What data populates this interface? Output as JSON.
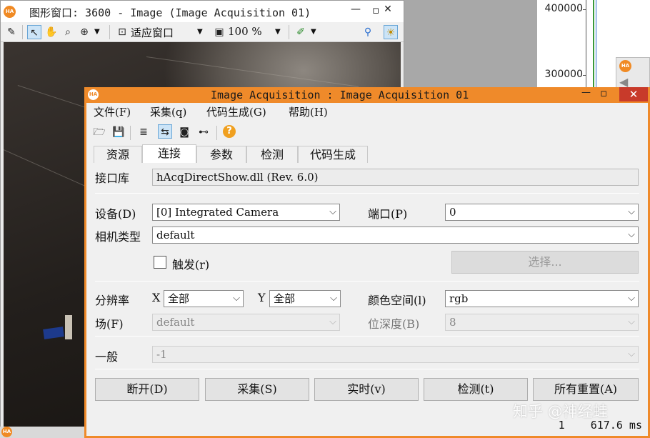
{
  "graphics_window": {
    "title": "图形窗口: 3600 - Image (Image Acquisition 01)",
    "zoom_mode": "适应窗口",
    "zoom_percent": "100 %",
    "min_glyph": "▭",
    "close_glyph": "✕"
  },
  "plot": {
    "y_ticks": [
      "400000",
      "300000"
    ]
  },
  "dialog": {
    "title": "Image Acquisition : Image Acquisition 01",
    "menu": [
      "文件(F)",
      "采集(q)",
      "代码生成(G)",
      "帮助(H)"
    ],
    "tabs": [
      "资源",
      "连接",
      "参数",
      "检测",
      "代码生成"
    ],
    "active_tab": "连接",
    "interface_label": "接口库",
    "interface_value": "hAcqDirectShow.dll (Rev. 6.0)",
    "device_label": "设备(D)",
    "device_value": "[0] Integrated Camera",
    "port_label": "端口(P)",
    "port_value": "0",
    "camera_type_label": "相机类型",
    "camera_type_value": "default",
    "trigger_label": "触发(r)",
    "select_button": "选择...",
    "resolution_label": "分辨率",
    "x_label": "X",
    "x_value": "全部",
    "y_label": "Y",
    "y_value": "全部",
    "color_space_label": "颜色空间(l)",
    "color_space_value": "rgb",
    "field_label": "场(F)",
    "field_value": "default",
    "bit_depth_label": "位深度(B)",
    "bit_depth_value": "8",
    "general_label": "一般",
    "general_value": "-1",
    "buttons": [
      "断开(D)",
      "采集(S)",
      "实时(v)",
      "检测(t)",
      "所有重置(A)"
    ],
    "status_count": "1",
    "status_time": "617.6 ms"
  },
  "watermark": "知乎 @神经蛙",
  "colors": {
    "dialog_accent": "#ef8a2a",
    "close_button": "#c83a2a"
  }
}
